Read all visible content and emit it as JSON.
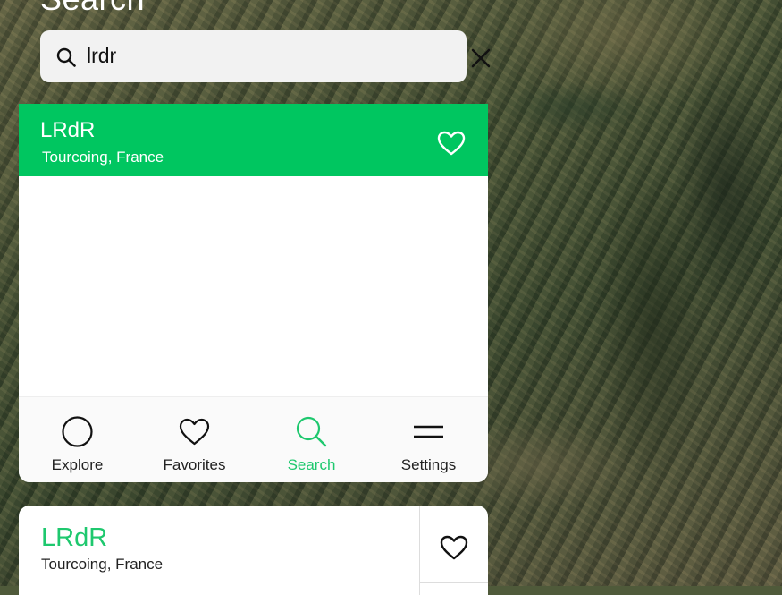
{
  "header": {
    "title": "Search"
  },
  "search": {
    "query": "lrdr"
  },
  "selected_result": {
    "name": "LRdR",
    "location": "Tourcoing, France"
  },
  "tabs": [
    {
      "label": "Explore",
      "icon": "circle-icon"
    },
    {
      "label": "Favorites",
      "icon": "heart-icon"
    },
    {
      "label": "Search",
      "icon": "search-icon",
      "active": true
    },
    {
      "label": "Settings",
      "icon": "menu-icon"
    }
  ],
  "results": [
    {
      "name": "LRdR",
      "location": "Tourcoing, France"
    }
  ],
  "colors": {
    "accent": "#1ec86e",
    "selected_bg": "#00c660",
    "search_bg": "#f2f2f2"
  }
}
